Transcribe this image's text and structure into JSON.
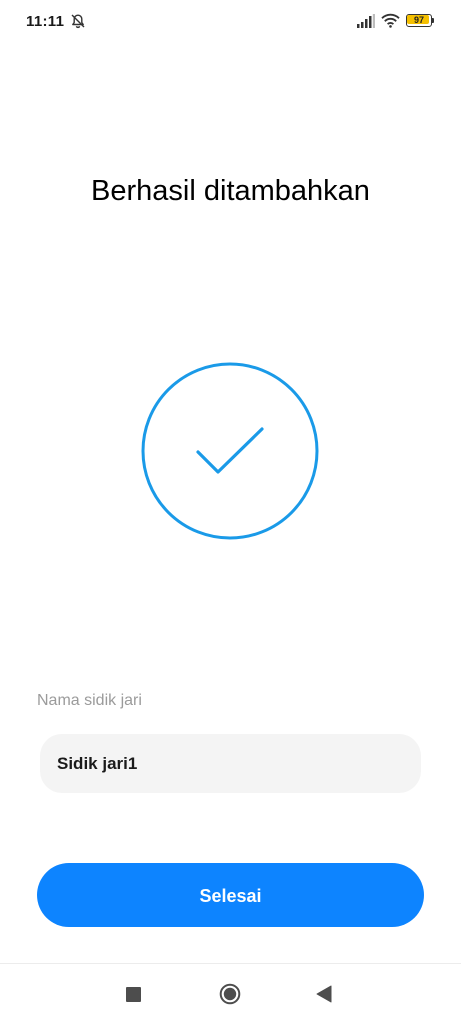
{
  "status_bar": {
    "time": "11:11",
    "notification_icon": "bell-off-icon",
    "signal_icon": "signal-icon",
    "wifi_icon": "wifi-icon",
    "battery_level": "97",
    "battery_color": "#f5c000"
  },
  "page": {
    "title": "Berhasil ditambahkan",
    "status_icon": "checkmark-circle-icon",
    "accent_color": "#1a9ae8"
  },
  "fingerprint_name": {
    "label": "Nama sidik jari",
    "value": "Sidik jari1"
  },
  "actions": {
    "done_label": "Selesai",
    "button_color": "#0d84ff"
  },
  "nav_bar": {
    "recents_icon": "square-recents-icon",
    "home_icon": "circle-home-icon",
    "back_icon": "triangle-back-icon"
  }
}
